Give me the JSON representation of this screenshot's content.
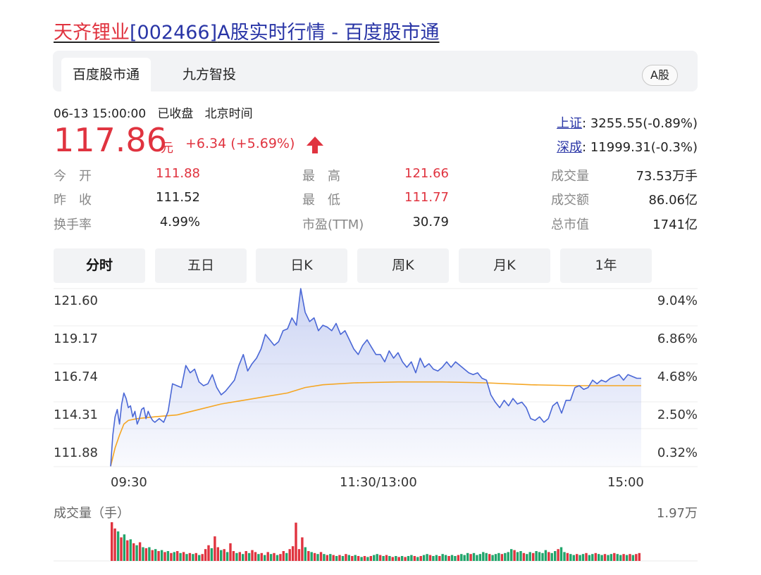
{
  "title": {
    "name": "天齐锂业",
    "code": "[002466]",
    "rest": "A股实时行情 - 百度股市通"
  },
  "tabs": [
    {
      "label": "百度股市通"
    },
    {
      "label": "九方智投"
    }
  ],
  "market_badge": "A股",
  "quote": {
    "time": "06-13 15:00:00",
    "status": "已收盘",
    "tz": "北京时间",
    "price": "117.86",
    "unit": "元",
    "change": "+6.34",
    "change_pct": "(+5.69%)"
  },
  "indices": [
    {
      "name": "上证",
      "value": ": 3255.55(-0.89%)"
    },
    {
      "name": "深成",
      "value": ": 11999.31(-0.3%)"
    }
  ],
  "stats": {
    "open": {
      "label": "今　开",
      "value": "111.88"
    },
    "prev": {
      "label": "昨　收",
      "value": "111.52"
    },
    "turn": {
      "label": "换手率",
      "value": "4.99%"
    },
    "high": {
      "label": "最　高",
      "value": "121.66"
    },
    "low": {
      "label": "最　低",
      "value": "111.77"
    },
    "pe": {
      "label": "市盈(TTM)",
      "value": "30.79"
    },
    "vol": {
      "label": "成交量",
      "value": "73.53万手"
    },
    "amt": {
      "label": "成交额",
      "value": "86.06亿"
    },
    "cap": {
      "label": "总市值",
      "value": "1741亿"
    }
  },
  "period_tabs": [
    "分时",
    "五日",
    "日K",
    "周K",
    "月K",
    "1年"
  ],
  "colors": {
    "up": "#e0333f",
    "down": "#21a56b",
    "price_line": "#4a67d6",
    "avg_line": "#f5a623",
    "link": "#2935a6"
  },
  "chart_data": {
    "type": "line",
    "y_left_ticks": [
      "121.60",
      "119.17",
      "116.74",
      "114.31",
      "111.88"
    ],
    "y_right_ticks": [
      "9.04%",
      "6.86%",
      "4.68%",
      "2.50%",
      "0.32%"
    ],
    "ylim": [
      111.88,
      121.6
    ],
    "x_ticks": [
      "09:30",
      "11:30/13:00",
      "15:00"
    ],
    "minutes_total": 240,
    "series": [
      {
        "role": "price",
        "points": [
          [
            0,
            111.9
          ],
          [
            1,
            113.6
          ],
          [
            2,
            114.6
          ],
          [
            3,
            115.0
          ],
          [
            4,
            114.2
          ],
          [
            5,
            115.3
          ],
          [
            6,
            115.9
          ],
          [
            7,
            115.6
          ],
          [
            8,
            115.1
          ],
          [
            9,
            115.2
          ],
          [
            10,
            114.6
          ],
          [
            11,
            114.9
          ],
          [
            12,
            114.2
          ],
          [
            13,
            114.5
          ],
          [
            14,
            115.0
          ],
          [
            15,
            115.1
          ],
          [
            16,
            114.5
          ],
          [
            17,
            114.9
          ],
          [
            18,
            114.6
          ],
          [
            19,
            114.4
          ],
          [
            20,
            114.3
          ],
          [
            22,
            114.5
          ],
          [
            24,
            114.3
          ],
          [
            26,
            114.9
          ],
          [
            28,
            116.4
          ],
          [
            30,
            116.3
          ],
          [
            32,
            116.2
          ],
          [
            34,
            117.4
          ],
          [
            36,
            117.0
          ],
          [
            38,
            117.2
          ],
          [
            40,
            116.5
          ],
          [
            42,
            116.3
          ],
          [
            44,
            116.4
          ],
          [
            46,
            116.9
          ],
          [
            48,
            116.2
          ],
          [
            50,
            115.8
          ],
          [
            52,
            116.0
          ],
          [
            54,
            116.3
          ],
          [
            56,
            116.6
          ],
          [
            58,
            117.4
          ],
          [
            60,
            118.0
          ],
          [
            62,
            117.1
          ],
          [
            64,
            117.5
          ],
          [
            66,
            117.8
          ],
          [
            68,
            118.3
          ],
          [
            70,
            119.1
          ],
          [
            72,
            118.8
          ],
          [
            74,
            118.5
          ],
          [
            76,
            118.7
          ],
          [
            78,
            119.3
          ],
          [
            80,
            119.4
          ],
          [
            82,
            120.0
          ],
          [
            84,
            119.6
          ],
          [
            86,
            121.6
          ],
          [
            88,
            120.3
          ],
          [
            90,
            119.8
          ],
          [
            92,
            120.0
          ],
          [
            94,
            119.3
          ],
          [
            96,
            119.6
          ],
          [
            98,
            119.5
          ],
          [
            100,
            119.3
          ],
          [
            102,
            119.7
          ],
          [
            104,
            119.1
          ],
          [
            106,
            119.3
          ],
          [
            108,
            118.8
          ],
          [
            110,
            118.3
          ],
          [
            112,
            118.0
          ],
          [
            114,
            118.5
          ],
          [
            116,
            118.8
          ],
          [
            118,
            118.4
          ],
          [
            120,
            118.0
          ],
          [
            122,
            118.0
          ],
          [
            124,
            117.6
          ],
          [
            126,
            118.2
          ],
          [
            128,
            117.8
          ],
          [
            130,
            118.1
          ],
          [
            132,
            117.6
          ],
          [
            134,
            117.3
          ],
          [
            136,
            117.6
          ],
          [
            138,
            117.0
          ],
          [
            140,
            117.8
          ],
          [
            142,
            117.3
          ],
          [
            144,
            117.5
          ],
          [
            146,
            117.2
          ],
          [
            148,
            117.1
          ],
          [
            150,
            117.3
          ],
          [
            152,
            117.6
          ],
          [
            154,
            117.3
          ],
          [
            156,
            117.6
          ],
          [
            158,
            117.4
          ],
          [
            160,
            117.2
          ],
          [
            162,
            117.0
          ],
          [
            164,
            116.9
          ],
          [
            166,
            117.0
          ],
          [
            168,
            116.7
          ],
          [
            170,
            116.6
          ],
          [
            172,
            115.8
          ],
          [
            174,
            115.4
          ],
          [
            176,
            115.1
          ],
          [
            178,
            115.5
          ],
          [
            180,
            115.2
          ],
          [
            182,
            115.6
          ],
          [
            184,
            115.3
          ],
          [
            186,
            115.4
          ],
          [
            188,
            115.1
          ],
          [
            190,
            114.5
          ],
          [
            192,
            114.4
          ],
          [
            194,
            114.6
          ],
          [
            196,
            114.3
          ],
          [
            198,
            114.5
          ],
          [
            200,
            115.2
          ],
          [
            202,
            115.4
          ],
          [
            204,
            114.8
          ],
          [
            206,
            115.5
          ],
          [
            208,
            115.5
          ],
          [
            210,
            116.2
          ],
          [
            212,
            116.3
          ],
          [
            214,
            116.1
          ],
          [
            216,
            116.2
          ],
          [
            218,
            116.6
          ],
          [
            220,
            116.4
          ],
          [
            222,
            116.6
          ],
          [
            224,
            116.5
          ],
          [
            226,
            116.7
          ],
          [
            228,
            116.8
          ],
          [
            230,
            116.9
          ],
          [
            232,
            116.6
          ],
          [
            234,
            116.9
          ],
          [
            236,
            116.8
          ],
          [
            238,
            116.7
          ],
          [
            240,
            116.7
          ]
        ]
      },
      {
        "role": "average",
        "points": [
          [
            0,
            111.9
          ],
          [
            2,
            112.9
          ],
          [
            4,
            113.6
          ],
          [
            6,
            114.2
          ],
          [
            8,
            114.4
          ],
          [
            12,
            114.5
          ],
          [
            20,
            114.6
          ],
          [
            30,
            114.7
          ],
          [
            40,
            115.0
          ],
          [
            50,
            115.3
          ],
          [
            60,
            115.5
          ],
          [
            70,
            115.7
          ],
          [
            80,
            115.9
          ],
          [
            88,
            116.2
          ],
          [
            96,
            116.35
          ],
          [
            110,
            116.45
          ],
          [
            130,
            116.5
          ],
          [
            150,
            116.5
          ],
          [
            170,
            116.45
          ],
          [
            190,
            116.35
          ],
          [
            210,
            116.3
          ],
          [
            240,
            116.3
          ]
        ]
      }
    ]
  },
  "volume": {
    "label": "成交量（手）",
    "max_label": "1.97万",
    "max": 19700,
    "bars": [
      [
        19700,
        1
      ],
      [
        16500,
        1
      ],
      [
        15000,
        -1
      ],
      [
        12000,
        1
      ],
      [
        13500,
        -1
      ],
      [
        10500,
        1
      ],
      [
        11000,
        -1
      ],
      [
        9000,
        1
      ],
      [
        8000,
        -1
      ],
      [
        9500,
        1
      ],
      [
        7000,
        -1
      ],
      [
        6500,
        1
      ],
      [
        7000,
        -1
      ],
      [
        5500,
        1
      ],
      [
        6000,
        -1
      ],
      [
        5000,
        1
      ],
      [
        5500,
        -1
      ],
      [
        4500,
        1
      ],
      [
        5000,
        -1
      ],
      [
        4000,
        1
      ],
      [
        4500,
        -1
      ],
      [
        5000,
        1
      ],
      [
        4000,
        -1
      ],
      [
        4500,
        1
      ],
      [
        3500,
        -1
      ],
      [
        4000,
        1
      ],
      [
        3500,
        -1
      ],
      [
        4000,
        1
      ],
      [
        3000,
        -1
      ],
      [
        3500,
        1
      ],
      [
        6000,
        1
      ],
      [
        8000,
        1
      ],
      [
        6500,
        -1
      ],
      [
        12500,
        1
      ],
      [
        7000,
        1
      ],
      [
        5500,
        -1
      ],
      [
        6000,
        1
      ],
      [
        4500,
        -1
      ],
      [
        9000,
        1
      ],
      [
        5000,
        1
      ],
      [
        4000,
        -1
      ],
      [
        4500,
        1
      ],
      [
        3500,
        -1
      ],
      [
        5000,
        1
      ],
      [
        4000,
        -1
      ],
      [
        5500,
        1
      ],
      [
        4500,
        1
      ],
      [
        3500,
        -1
      ],
      [
        4000,
        1
      ],
      [
        3000,
        -1
      ],
      [
        4500,
        1
      ],
      [
        3500,
        -1
      ],
      [
        4000,
        1
      ],
      [
        3000,
        -1
      ],
      [
        3500,
        1
      ],
      [
        5000,
        1
      ],
      [
        4000,
        -1
      ],
      [
        6000,
        1
      ],
      [
        7500,
        1
      ],
      [
        19500,
        1
      ],
      [
        6000,
        1
      ],
      [
        12000,
        1
      ],
      [
        7000,
        -1
      ],
      [
        5000,
        1
      ],
      [
        4500,
        -1
      ],
      [
        4000,
        1
      ],
      [
        3500,
        -1
      ],
      [
        4500,
        1
      ],
      [
        3500,
        -1
      ],
      [
        3000,
        1
      ],
      [
        3500,
        -1
      ],
      [
        3000,
        1
      ],
      [
        2500,
        -1
      ],
      [
        3000,
        1
      ],
      [
        2500,
        -1
      ],
      [
        3500,
        1
      ],
      [
        3000,
        -1
      ],
      [
        2500,
        1
      ],
      [
        3000,
        -1
      ],
      [
        2500,
        1
      ],
      [
        2000,
        -1
      ],
      [
        2500,
        1
      ],
      [
        2000,
        -1
      ],
      [
        2500,
        1
      ],
      [
        3000,
        -1
      ],
      [
        3500,
        -1
      ],
      [
        3000,
        1
      ],
      [
        2500,
        -1
      ],
      [
        3000,
        1
      ],
      [
        2500,
        -1
      ],
      [
        2000,
        1
      ],
      [
        2500,
        -1
      ],
      [
        2000,
        1
      ],
      [
        2500,
        -1
      ],
      [
        2000,
        1
      ],
      [
        2500,
        -1
      ],
      [
        3000,
        -1
      ],
      [
        2500,
        1
      ],
      [
        2000,
        -1
      ],
      [
        2500,
        1
      ],
      [
        3000,
        -1
      ],
      [
        3500,
        -1
      ],
      [
        3000,
        1
      ],
      [
        2500,
        -1
      ],
      [
        3000,
        -1
      ],
      [
        2500,
        1
      ],
      [
        3500,
        -1
      ],
      [
        3000,
        -1
      ],
      [
        2500,
        1
      ],
      [
        3000,
        -1
      ],
      [
        2500,
        -1
      ],
      [
        3000,
        1
      ],
      [
        3500,
        -1
      ],
      [
        3000,
        -1
      ],
      [
        4000,
        -1
      ],
      [
        3500,
        1
      ],
      [
        4000,
        -1
      ],
      [
        3000,
        -1
      ],
      [
        3500,
        -1
      ],
      [
        4500,
        -1
      ],
      [
        4000,
        -1
      ],
      [
        3500,
        1
      ],
      [
        3000,
        -1
      ],
      [
        3500,
        -1
      ],
      [
        4000,
        -1
      ],
      [
        3500,
        1
      ],
      [
        4000,
        -1
      ],
      [
        4500,
        -1
      ],
      [
        6000,
        -1
      ],
      [
        5500,
        1
      ],
      [
        4500,
        -1
      ],
      [
        5000,
        -1
      ],
      [
        4000,
        1
      ],
      [
        3500,
        -1
      ],
      [
        4500,
        -1
      ],
      [
        4000,
        1
      ],
      [
        5000,
        -1
      ],
      [
        4500,
        -1
      ],
      [
        4000,
        -1
      ],
      [
        5500,
        -1
      ],
      [
        4500,
        1
      ],
      [
        4000,
        -1
      ],
      [
        5000,
        -1
      ],
      [
        6000,
        1
      ],
      [
        7000,
        -1
      ],
      [
        4500,
        -1
      ],
      [
        4000,
        1
      ],
      [
        3500,
        -1
      ],
      [
        3000,
        -1
      ],
      [
        3500,
        1
      ],
      [
        3000,
        -1
      ],
      [
        3500,
        -1
      ],
      [
        4000,
        1
      ],
      [
        3000,
        -1
      ],
      [
        3500,
        -1
      ],
      [
        4000,
        1
      ],
      [
        3500,
        -1
      ],
      [
        3000,
        -1
      ],
      [
        3500,
        1
      ],
      [
        3000,
        -1
      ],
      [
        3500,
        -1
      ],
      [
        4000,
        1
      ],
      [
        3500,
        -1
      ],
      [
        3000,
        -1
      ],
      [
        3500,
        1
      ],
      [
        3000,
        -1
      ],
      [
        3500,
        1
      ],
      [
        3000,
        -1
      ],
      [
        3500,
        1
      ],
      [
        4000,
        1
      ]
    ]
  }
}
